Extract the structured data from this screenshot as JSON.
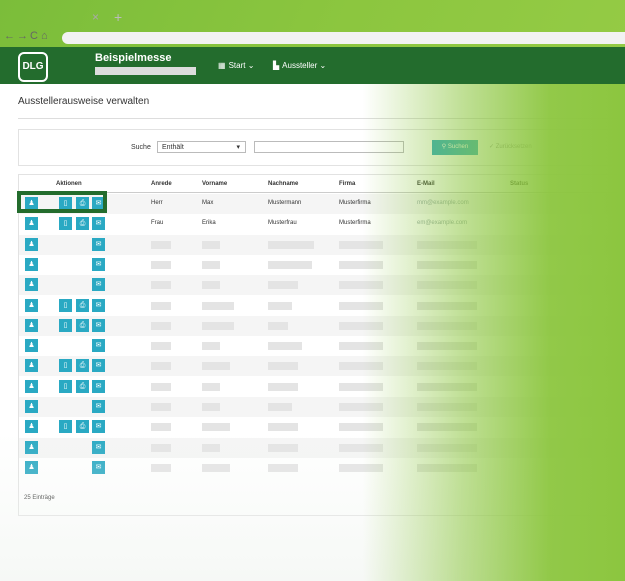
{
  "browser": {
    "tab_close": "×",
    "tab_new": "+",
    "nav_back": "←",
    "nav_forward": "→",
    "nav_reload": "C",
    "nav_home": "⌂"
  },
  "header": {
    "logo": "DLG",
    "title": "Beispielmesse",
    "menu_start": "Start",
    "menu_aussteller": "Aussteller",
    "caret": "⌄"
  },
  "page": {
    "title": "Ausstellerausweise verwalten"
  },
  "search": {
    "label": "Suche",
    "mode": "Enthält",
    "button": "Suchen",
    "reset": "Zurücksetzen"
  },
  "table": {
    "headers": [
      "Aktionen",
      "Anrede",
      "Vorname",
      "Nachname",
      "Firma",
      "E-Mail",
      "Status"
    ],
    "rows": [
      {
        "anrede": "Herr",
        "vorname": "Max",
        "nachname": "Mustermann",
        "firma": "Musterfirma",
        "email": "mm@example.com",
        "actions": [
          "user",
          "mobile",
          "pdf",
          "mail"
        ]
      },
      {
        "anrede": "Frau",
        "vorname": "Erika",
        "nachname": "Musterfrau",
        "firma": "Musterfirma",
        "email": "em@example.com",
        "actions": [
          "user",
          "mobile",
          "pdf",
          "mail"
        ]
      },
      {
        "actions": [
          "user",
          "mail"
        ]
      },
      {
        "actions": [
          "user",
          "mail"
        ]
      },
      {
        "actions": [
          "user",
          "mail"
        ]
      },
      {
        "actions": [
          "user",
          "mobile",
          "pdf",
          "mail"
        ]
      },
      {
        "actions": [
          "user",
          "mobile",
          "pdf",
          "mail"
        ]
      },
      {
        "actions": [
          "user",
          "mail"
        ]
      },
      {
        "actions": [
          "user",
          "mobile",
          "pdf",
          "mail"
        ]
      },
      {
        "actions": [
          "user",
          "mobile",
          "pdf",
          "mail"
        ]
      },
      {
        "actions": [
          "user",
          "mail"
        ]
      },
      {
        "actions": [
          "user",
          "mobile",
          "pdf",
          "mail"
        ]
      },
      {
        "actions": [
          "user",
          "mail"
        ]
      },
      {
        "actions": [
          "user",
          "mail"
        ]
      }
    ],
    "count": "25 Einträge"
  },
  "colors": {
    "header_green": "#236c2d",
    "action_blue": "#2aa9c3",
    "bg_green": "#8cc63f"
  }
}
